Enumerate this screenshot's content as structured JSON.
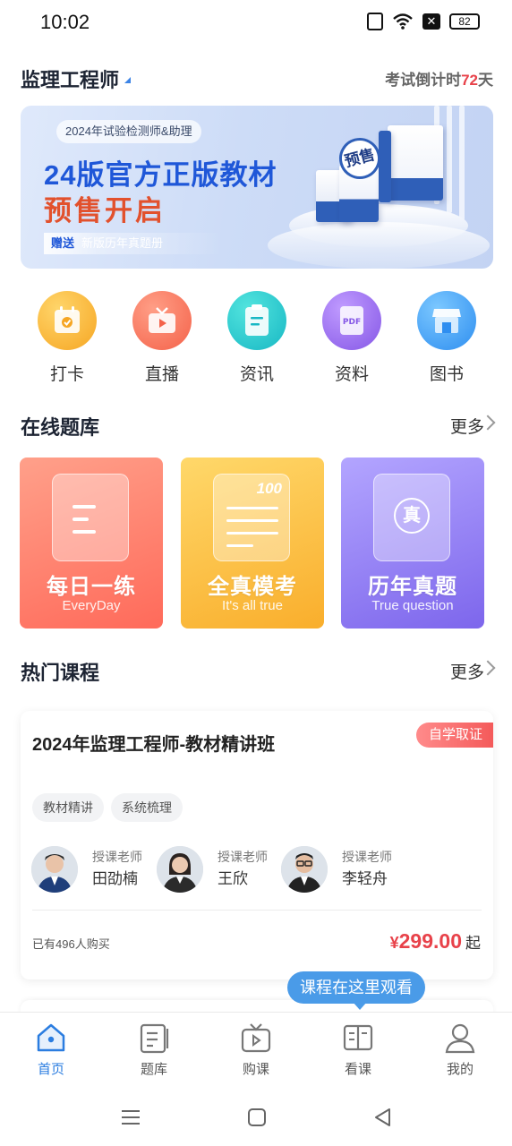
{
  "status": {
    "time": "10:02",
    "battery": "82"
  },
  "header": {
    "app_title": "监理工程师",
    "countdown_label": "考试倒计时",
    "countdown_days": "72",
    "countdown_unit": "天"
  },
  "banner": {
    "tag": "2024年试验检测师&助理",
    "headline1": "24版官方正版教材",
    "headline2": "预售开启",
    "gift_prefix": "赠送",
    "gift_text": "新版历年真题册",
    "stamp": "预售"
  },
  "quick_entries": [
    {
      "label": "打卡",
      "icon": "calendar-check-icon",
      "color": "#f9b53c"
    },
    {
      "label": "直播",
      "icon": "tv-play-icon",
      "color": "#f7715a"
    },
    {
      "label": "资讯",
      "icon": "document-icon",
      "color": "#26c9c9"
    },
    {
      "label": "资料",
      "icon": "pdf-icon",
      "color": "#9b72ee"
    },
    {
      "label": "图书",
      "icon": "store-icon",
      "color": "#3fa6f2"
    }
  ],
  "question_bank": {
    "title": "在线题库",
    "more": "更多",
    "cards": [
      {
        "title": "每日一练",
        "subtitle": "EveryDay",
        "color": "#ff7a67"
      },
      {
        "title": "全真模考",
        "subtitle": "It's all true",
        "badge": "100",
        "color": "#fbbe3a"
      },
      {
        "title": "历年真题",
        "subtitle": "True question",
        "seal": "真",
        "color": "#8f7cf0"
      }
    ]
  },
  "hot_courses": {
    "title": "热门课程",
    "more": "更多",
    "course": {
      "title": "2024年监理工程师-教材精讲班",
      "badge": "自学取证",
      "tags": [
        "教材精讲",
        "系统梳理"
      ],
      "teachers": [
        {
          "role": "授课老师",
          "name": "田劭楠"
        },
        {
          "role": "授课老师",
          "name": "王欣"
        },
        {
          "role": "授课老师",
          "name": "李轻舟"
        }
      ],
      "buyers": "已有496人购买",
      "currency": "¥",
      "price": "299.00",
      "price_suffix": "起"
    }
  },
  "tooltip": "课程在这里观看",
  "tabbar": [
    {
      "label": "首页",
      "icon": "home-icon",
      "active": true
    },
    {
      "label": "题库",
      "icon": "question-bank-icon",
      "active": false
    },
    {
      "label": "购课",
      "icon": "buy-course-icon",
      "active": false
    },
    {
      "label": "看课",
      "icon": "watch-course-icon",
      "active": false
    },
    {
      "label": "我的",
      "icon": "profile-icon",
      "active": false
    }
  ],
  "colors": {
    "accent": "#2b7de0",
    "price_red": "#e8424a",
    "tooltip_blue": "#4a9be8"
  }
}
